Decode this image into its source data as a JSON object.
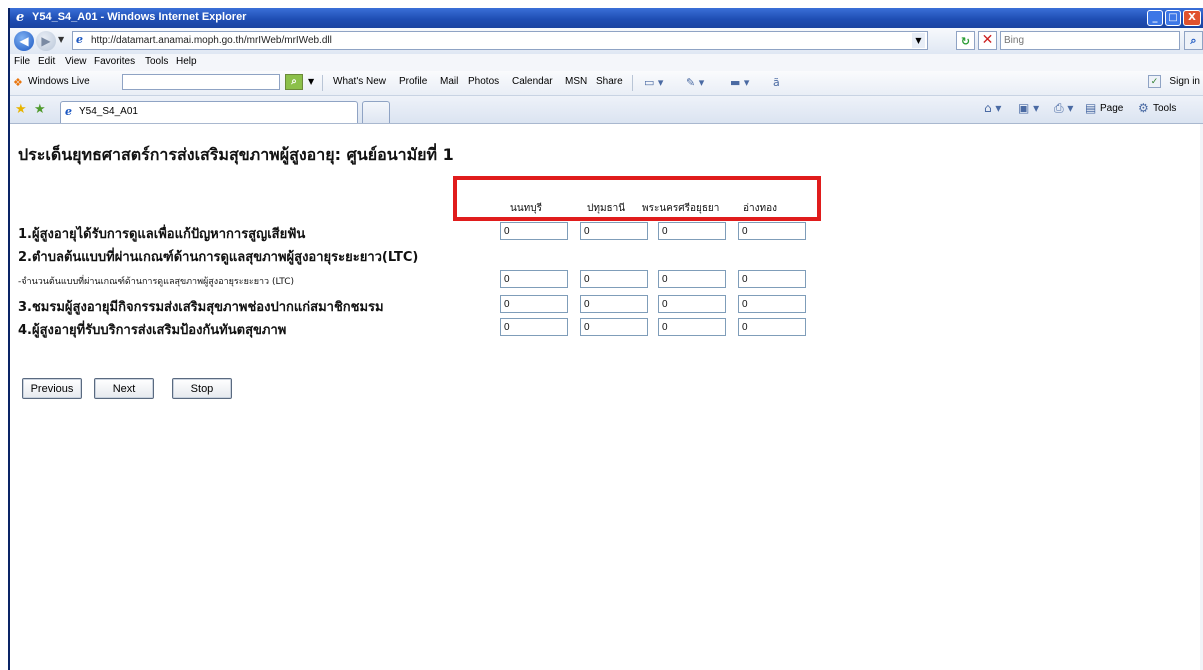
{
  "window": {
    "title": "Y54_S4_A01 - Windows Internet Explorer",
    "min_glyph": "_",
    "max_glyph": "□",
    "close_glyph": "X"
  },
  "addressbar": {
    "url": "http://datamart.anamai.moph.go.th/mrIWeb/mrIWeb.dll",
    "search_placeholder": "Bing"
  },
  "menu": [
    "File",
    "Edit",
    "View",
    "Favorites",
    "Tools",
    "Help"
  ],
  "livebar": {
    "label": "Windows Live",
    "items": [
      "What's New",
      "Profile",
      "Mail",
      "Photos",
      "Calendar",
      "MSN",
      "Share"
    ],
    "signin": "Sign in"
  },
  "tabs": {
    "active_label": "Y54_S4_A01",
    "commands": [
      "Page",
      "Tools"
    ]
  },
  "page": {
    "title": "ประเด็นยุทธศาสตร์การส่งเสริมสุขภาพผู้สูงอายุ: ศูนย์อนามัยที่ 1",
    "columns": [
      "นนทบุรี",
      "ปทุมธานี",
      "พระนครศรีอยุธยา",
      "อ่างทอง"
    ],
    "questions": [
      {
        "label": "1.ผู้สูงอายุได้รับการดูแลเพื่อแก้ปัญหาการสูญเสียฟัน",
        "values": [
          "0",
          "0",
          "0",
          "0"
        ]
      },
      {
        "label": "2.ตำบลต้นแบบที่ผ่านเกณฑ์ด้านการดูแลสุขภาพผู้สูงอายุระยะยาว(LTC)"
      },
      {
        "label": "-จำนวนต้นแบบที่ผ่านเกณฑ์ด้านการดูแลสุขภาพผู้สูงอายุระยะยาว (LTC)",
        "values": [
          "0",
          "0",
          "0",
          "0"
        ]
      },
      {
        "label": "3.ชมรมผู้สูงอายุมีกิจกรรมส่งเสริมสุขภาพช่องปากแก่สมาชิกชมรม",
        "values": [
          "0",
          "0",
          "0",
          "0"
        ]
      },
      {
        "label": "4.ผู้สูงอายุที่รับบริการส่งเสริมป้องกันทันตสุขภาพ",
        "values": [
          "0",
          "0",
          "0",
          "0"
        ]
      }
    ],
    "buttons": {
      "previous": "Previous",
      "next": "Next",
      "stop": "Stop"
    }
  },
  "colors": {
    "highlight": "#e01c1c",
    "titlebar": "#1f4eb4"
  }
}
